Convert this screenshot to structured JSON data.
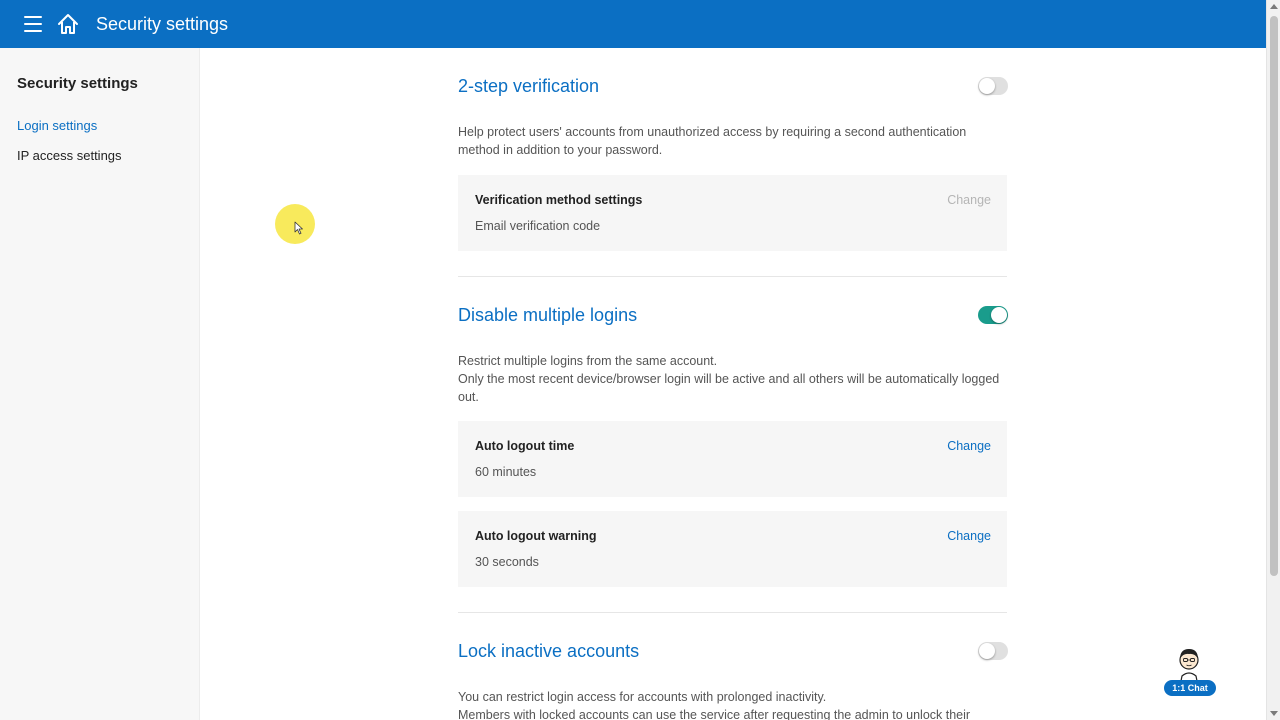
{
  "header": {
    "title": "Security settings",
    "menu_icon": "hamburger-menu-icon",
    "home_icon": "home-icon",
    "bg_color": "#0b6fc3"
  },
  "sidebar": {
    "title": "Security settings",
    "items": [
      {
        "label": "Login settings",
        "active": true
      },
      {
        "label": "IP access settings",
        "active": false
      }
    ]
  },
  "sections": {
    "two_step": {
      "title": "2-step verification",
      "enabled": false,
      "description": "Help protect users' accounts from unauthorized access by requiring a second authentication method in addition to your password.",
      "cards": [
        {
          "label": "Verification method settings",
          "value": "Email verification code",
          "action": "Change",
          "action_enabled": false
        }
      ]
    },
    "multi_login": {
      "title": "Disable multiple logins",
      "enabled": true,
      "description_line1": "Restrict multiple logins from the same account.",
      "description_line2": "Only the most recent device/browser login will be active and all others will be automatically logged out.",
      "cards": [
        {
          "label": "Auto logout time",
          "value": "60 minutes",
          "action": "Change",
          "action_enabled": true
        },
        {
          "label": "Auto logout warning",
          "value": "30 seconds",
          "action": "Change",
          "action_enabled": true
        }
      ]
    },
    "lock_inactive": {
      "title": "Lock inactive accounts",
      "enabled": false,
      "description_line1": "You can restrict login access for accounts with prolonged inactivity.",
      "description_line2": "Members with locked accounts can use the service after requesting the admin to unlock their"
    }
  },
  "chat": {
    "label": "1:1 Chat"
  },
  "colors": {
    "accent": "#0b6fc3",
    "toggle_on": "#1a9c8c",
    "toggle_off": "#e0e0e0",
    "card_bg": "#f6f6f6"
  }
}
